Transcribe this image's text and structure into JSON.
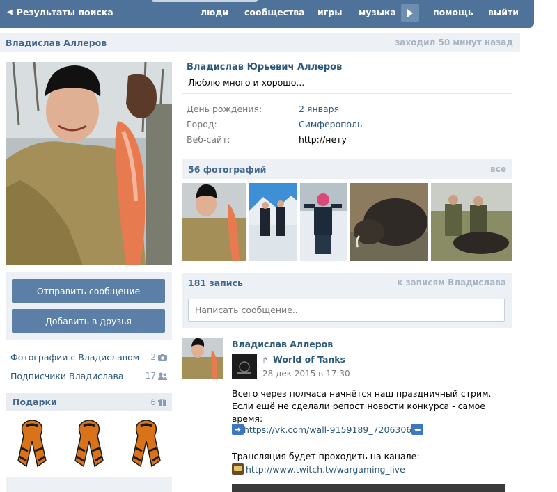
{
  "topbar": {
    "back_label": "Результаты поиска",
    "nav": [
      "люди",
      "сообщества",
      "игры",
      "музыка",
      "помощь",
      "выйти"
    ]
  },
  "header": {
    "name": "Владислав Аллеров",
    "last_seen": "заходил 50 минут назад"
  },
  "left": {
    "send_message": "Отправить сообщение",
    "add_friend": "Добавить в друзья",
    "photos_with": {
      "label": "Фотографии с Владиславом",
      "count": "2"
    },
    "followers": {
      "label": "Подписчики Владислава",
      "count": "17"
    },
    "gifts": {
      "title": "Подарки",
      "count": "6"
    }
  },
  "profile": {
    "full_name": "Владислав Юрьевич Аллеров",
    "status": "Люблю много и хорошо...",
    "info": [
      {
        "label": "День рождения:",
        "value": "2 января"
      },
      {
        "label": "Город:",
        "value": "Симферополь"
      },
      {
        "label": "Веб-сайт:",
        "value": "http://нету"
      }
    ]
  },
  "photos": {
    "title": "56 фотографий",
    "all_link": "все"
  },
  "wall": {
    "title": "181 запись",
    "link": "к записям Владислава",
    "placeholder": "Написать сообщение.."
  },
  "post": {
    "author": "Владислав Аллеров",
    "repost_source": "World of Tanks",
    "date": "28 дек 2015 в 17:30",
    "text": "Всего через полчаса начнётся наш праздничный стрим. Если ещё не сделали репост новости конкурса - самое время:",
    "link1": "https://vk.com/wall-9159189_7206306",
    "line2": "Трансляция будет проходить на канале:",
    "link2": "http://www.twitch.tv/wargaming_live"
  },
  "icons": [
    "back-arrow-icon",
    "chevron-right-icon",
    "camera-icon",
    "people-icon",
    "gift-icon",
    "share-icon",
    "arrow-right-emoji",
    "arrow-left-emoji",
    "tv-icon"
  ]
}
